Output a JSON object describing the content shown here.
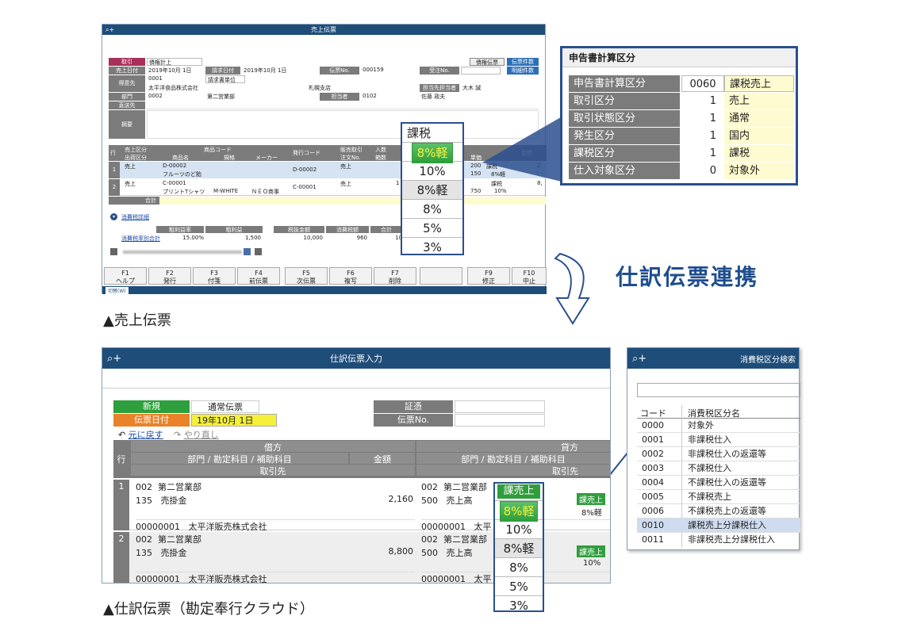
{
  "sales": {
    "title": "売上伝票",
    "icon": "search-plus-icon",
    "btn_credit": "債権伝票",
    "btn_count": "伝票件数",
    "btn_detail": "明細件数",
    "lbl_type": "取引",
    "val_type": "債権計上",
    "lbl_date": "売上日付",
    "val_date": "2019年10月 1日",
    "lbl_bill": "請求日付",
    "val_bill": "2019年10月 1日",
    "lbl_no": "伝票No.",
    "val_no": "000159",
    "lbl_order": "受注No.",
    "lbl_cust": "得意先",
    "val_cust_code": "0001",
    "val_cust_unit": "請求書単位",
    "val_cust_name": "太平洋食品株式会社",
    "val_branch": "札幌支店",
    "lbl_contact": "担当先担当者",
    "val_contact": "大木 誠",
    "lbl_dept": "部門",
    "val_dept_code": "0002",
    "val_dept_name": "第二営業部",
    "lbl_staff": "担当者",
    "val_staff_code": "0102",
    "val_staff_name": "佐藤 政夫",
    "lbl_ship": "直送先",
    "lbl_memo": "摘要",
    "grid_headers": [
      "行",
      "売上区分",
      "出荷区分",
      "商品コード",
      "商品名",
      "規格",
      "メーカー",
      "発行コード",
      "販売取引",
      "注文No.",
      "入数",
      "箱数",
      "単価",
      "金額"
    ],
    "rows": [
      {
        "no": "1",
        "kind": "売上",
        "code": "D-00002",
        "name": "フルーツのど飴",
        "spec": "",
        "maker": "",
        "issue": "D-00002",
        "trade": "売上",
        "price": "200",
        "qty": "150",
        "tax": "課税",
        "taxrate": "8%軽",
        "amount": "2,"
      },
      {
        "no": "2",
        "kind": "売上",
        "code": "C-00001",
        "name": "プリントTシャツ",
        "spec": "M-WHITE",
        "maker": "ＮＥＯ商事",
        "issue": "C-00001",
        "trade": "売上",
        "price": "750",
        "qty": "1",
        "tax": "課税",
        "taxrate": "10%",
        "amount": "8,"
      }
    ],
    "total_label": "合計",
    "tax_detail": "消費税詳細",
    "sum_headers": [
      "粗利益率",
      "粗利益",
      "税抜金額",
      "消費税額",
      "合計"
    ],
    "sum_label": "消費税率別合計",
    "sum_values": [
      "15.00%",
      "1,500",
      "10,000",
      "960",
      "10"
    ],
    "fkeys": [
      {
        "k": "F1",
        "l": "ヘルプ"
      },
      {
        "k": "F2",
        "l": "発行"
      },
      {
        "k": "F3",
        "l": "付箋"
      },
      {
        "k": "F4",
        "l": "前伝票"
      },
      {
        "k": "F5",
        "l": "次伝票"
      },
      {
        "k": "F6",
        "l": "複写"
      },
      {
        "k": "F7",
        "l": "削除"
      },
      {
        "k": "",
        "l": ""
      },
      {
        "k": "F9",
        "l": "修正"
      },
      {
        "k": "F10",
        "l": "中止"
      }
    ],
    "status": "切替(W)",
    "dropdown": {
      "header": "課税",
      "items": [
        "8%軽",
        "10%",
        "8%軽",
        "8%",
        "5%",
        "3%"
      ]
    }
  },
  "caption1": "▲売上伝票",
  "tax_panel": {
    "title": "申告書計算区分",
    "rows": [
      {
        "label": "申告書計算区分",
        "code": "0060",
        "value": "課税売上"
      },
      {
        "label": "取引区分",
        "code": "1",
        "value": "売上"
      },
      {
        "label": "取引状態区分",
        "code": "1",
        "value": "通常"
      },
      {
        "label": "発生区分",
        "code": "1",
        "value": "国内"
      },
      {
        "label": "課税区分",
        "code": "1",
        "value": "課税"
      },
      {
        "label": "仕入対象区分",
        "code": "0",
        "value": "対象外"
      }
    ]
  },
  "link_label": "仕訳伝票連携",
  "journal": {
    "title": "仕訳伝票入力",
    "icon": "search-plus-icon",
    "lbl_new": "新規",
    "val_type": "通常伝票",
    "lbl_date": "伝票日付",
    "val_date": "19年10月 1日",
    "lbl_cert": "証憑",
    "lbl_no": "伝票No.",
    "undo": "元に戻す",
    "redo": "やり直し",
    "debit": "借方",
    "credit": "貸方",
    "col_row": "行",
    "col_acct": "部門 / 勘定科目 / 補助科目",
    "col_amt": "金額",
    "col_partner": "取引先",
    "rows": [
      {
        "no": "1",
        "dept": "002",
        "dept_name": "第二営業部",
        "acct": "135",
        "acct_name": "売掛金",
        "amount": "2,160",
        "partner_code": "00000001",
        "partner_name": "太平洋販売株式会社",
        "c_dept": "002",
        "c_dept_name": "第二営業部",
        "c_acct": "500",
        "c_acct_name": "売上高",
        "c_partner_code": "00000001",
        "c_partner_name": "太平",
        "tax_tag": "課売上",
        "rate": "8%軽"
      },
      {
        "no": "2",
        "dept": "002",
        "dept_name": "第二営業部",
        "acct": "135",
        "acct_name": "売掛金",
        "amount": "8,800",
        "partner_code": "00000001",
        "partner_name": "太平洋販売株式会社",
        "c_dept": "002",
        "c_dept_name": "第二営業部",
        "c_acct": "500",
        "c_acct_name": "売上高",
        "c_partner_code": "00000001",
        "c_partner_name": "太平",
        "tax_tag": "課売上",
        "rate": "10%"
      }
    ],
    "dropdown": {
      "header": "課売上",
      "items": [
        "8%軽",
        "10%",
        "8%軽",
        "8%",
        "5%",
        "3%"
      ]
    }
  },
  "caption2": "▲仕訳伝票（勘定奉行クラウド）",
  "search": {
    "title": "消費税区分検索",
    "icon": "search-plus-icon",
    "col_code": "コード",
    "col_name": "消費税区分名",
    "rows": [
      {
        "code": "0000",
        "name": "対象外"
      },
      {
        "code": "0001",
        "name": "非課税仕入"
      },
      {
        "code": "0002",
        "name": "非課税仕入の返還等"
      },
      {
        "code": "0003",
        "name": "不課税仕入"
      },
      {
        "code": "0004",
        "name": "不課税仕入の返還等"
      },
      {
        "code": "0005",
        "name": "不課税売上"
      },
      {
        "code": "0006",
        "name": "不課税売上の返還等"
      },
      {
        "code": "0010",
        "name": "課税売上分課税仕入"
      },
      {
        "code": "0011",
        "name": "非課税売上分課税仕入"
      }
    ],
    "selected_index": 7
  },
  "colors": {
    "titlebar": "#1f4d7a",
    "header_gray": "#7b7b7b",
    "green": "#2f9e3c",
    "orange": "#e8832a",
    "yellow": "#f5f03a",
    "sel": "#cfdcf0"
  }
}
